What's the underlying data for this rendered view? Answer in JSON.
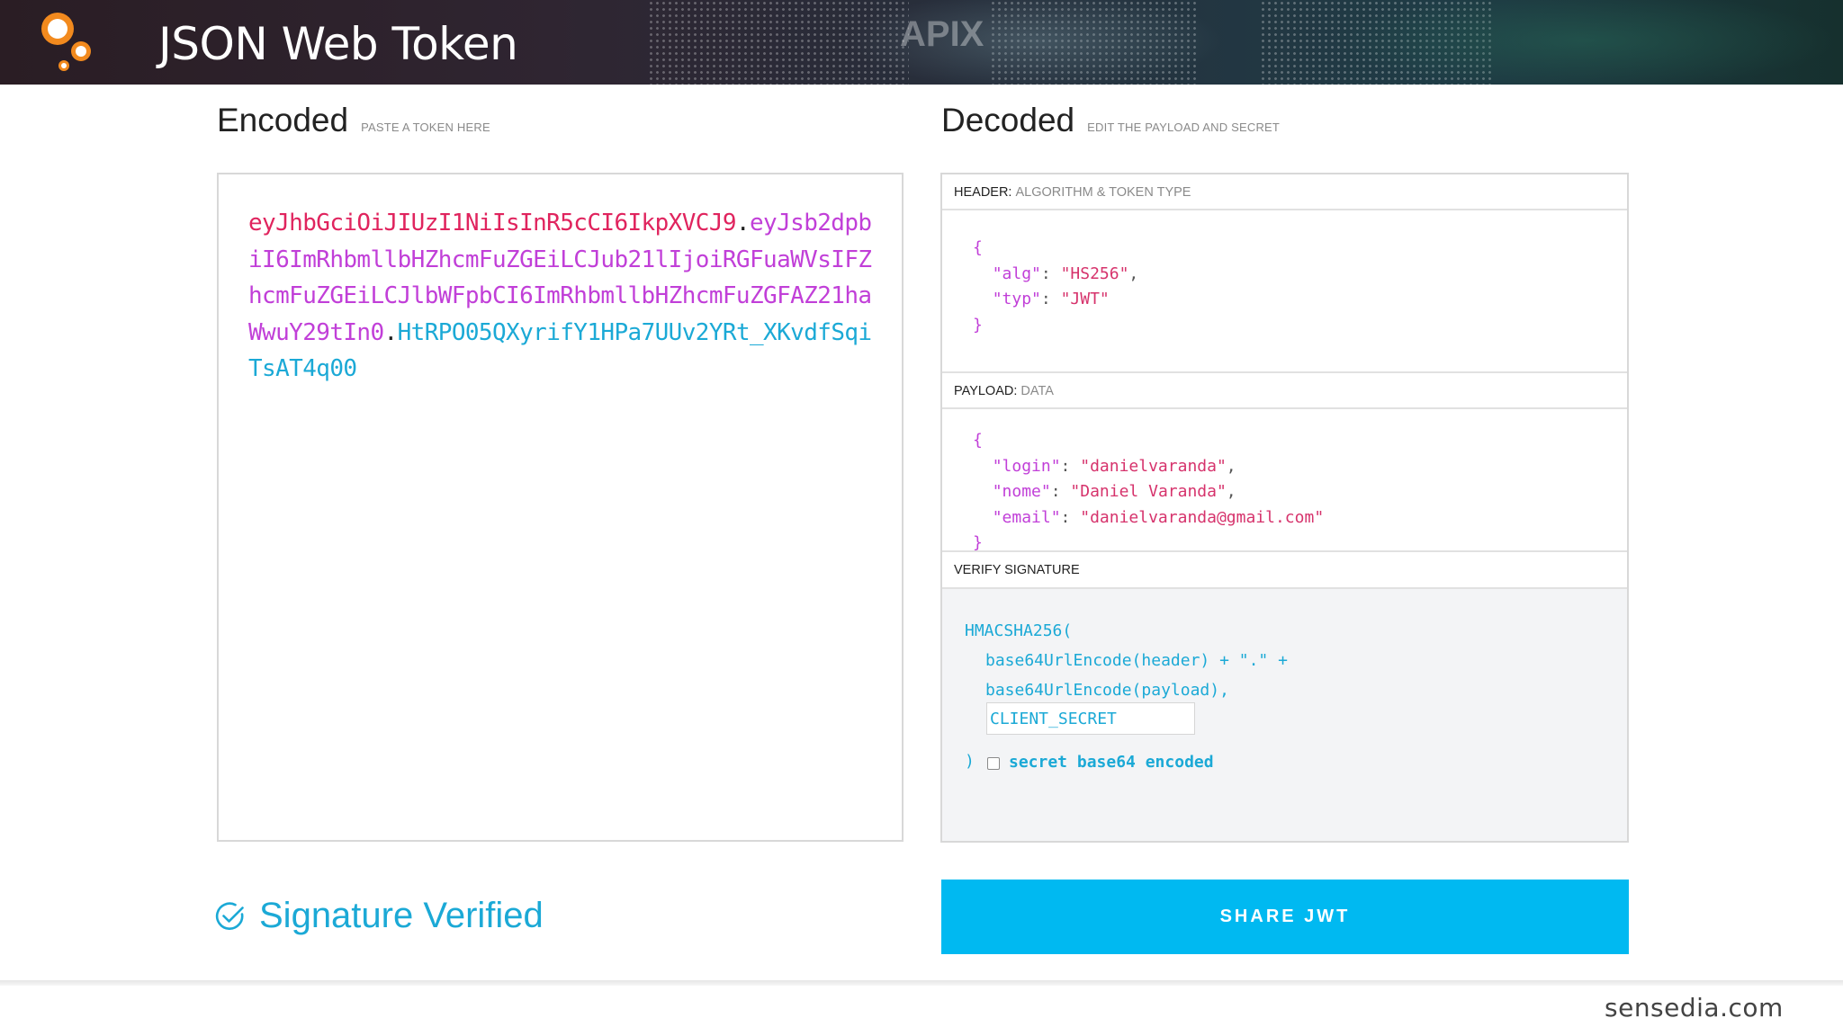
{
  "banner": {
    "title": "JSON Web Token",
    "background_mark": "APIX"
  },
  "encoded": {
    "heading": "Encoded",
    "hint": "PASTE A TOKEN HERE",
    "token_header": "eyJhbGciOiJIUzI1NiIsInR5cCI6IkpXVCJ9",
    "token_payload": "eyJsb2dpbiI6ImRhbmllbHZhcmFuZGEiLCJub21lIjoiRGFuaWVsIFZhcmFuZGEiLCJlbWFpbCI6ImRhbmllbHZhcmFuZGFAZ21haWwuY29tIn0",
    "token_signature": "HtRPO05QXyrifY1HPa7UUv2YRt_XKvdfSqiTsAT4q00",
    "dot": "."
  },
  "decoded": {
    "heading": "Decoded",
    "hint": "EDIT THE PAYLOAD AND SECRET",
    "header_section": {
      "label": "HEADER:",
      "sublabel": "ALGORITHM & TOKEN TYPE",
      "fields": [
        {
          "key": "\"alg\"",
          "value": "\"HS256\""
        },
        {
          "key": "\"typ\"",
          "value": "\"JWT\""
        }
      ]
    },
    "payload_section": {
      "label": "PAYLOAD:",
      "sublabel": "DATA",
      "fields": [
        {
          "key": "\"login\"",
          "value": "\"danielvaranda\""
        },
        {
          "key": "\"nome\"",
          "value": "\"Daniel Varanda\""
        },
        {
          "key": "\"email\"",
          "value": "\"danielvaranda@gmail.com\""
        }
      ]
    },
    "verify_section": {
      "label": "VERIFY SIGNATURE",
      "fn_open": "HMACSHA256(",
      "line1": "base64UrlEncode(header) + \".\" +",
      "line2": "base64UrlEncode(payload),",
      "secret_value": "CLIENT_SECRET",
      "fn_close": ")",
      "checkbox_label": "secret base64 encoded"
    }
  },
  "json_syntax": {
    "open": "{",
    "close": "}",
    "colon": ": ",
    "comma": ","
  },
  "status": {
    "verified_text": "Signature Verified"
  },
  "share": {
    "label": "SHARE JWT"
  },
  "footer": {
    "brand": "sensedia.com"
  },
  "colors": {
    "token_header": "#e0245e",
    "token_payload": "#c13fd8",
    "token_signature": "#1ba9d6",
    "accent": "#00b9f1",
    "logo_orange": "#f28a1e"
  }
}
